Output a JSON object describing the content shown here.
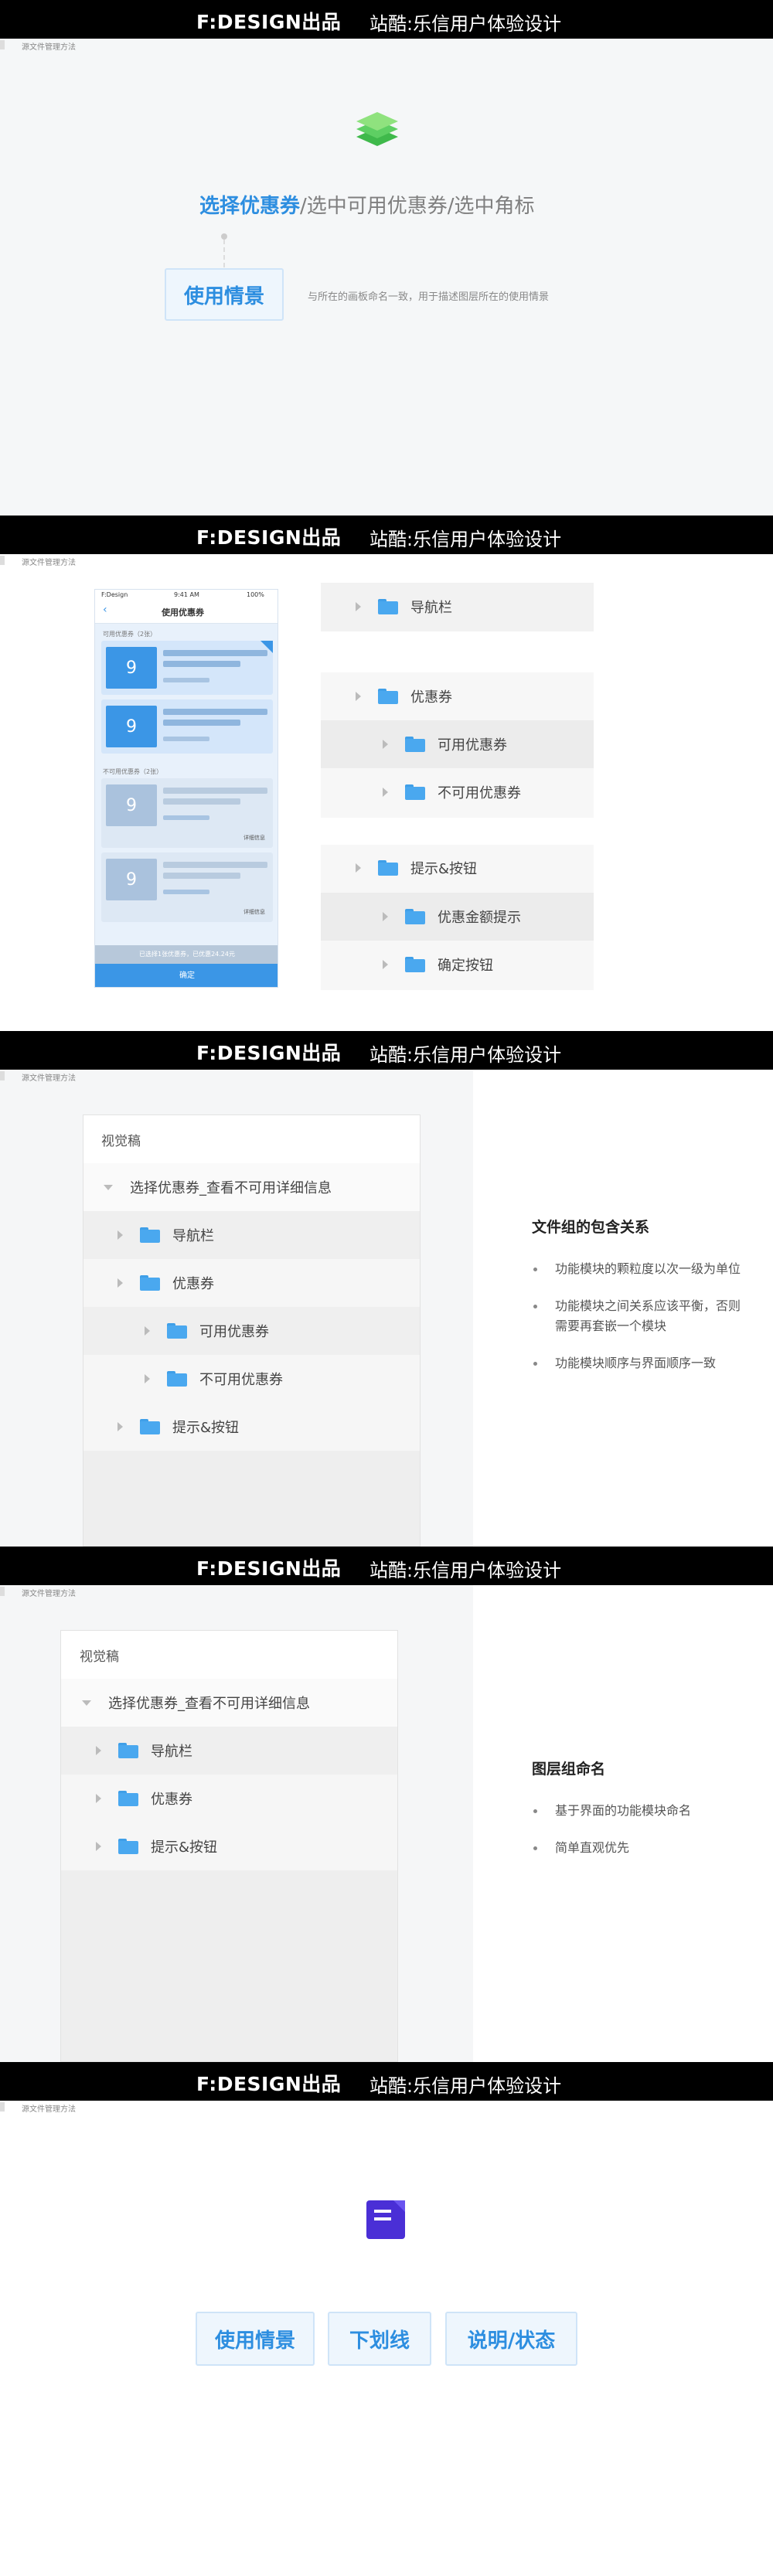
{
  "banner": {
    "logo": "F:DESIGN出品",
    "tagline": "站酷:乐信用户体验设计"
  },
  "micro_label": "源文件管理方法",
  "section1": {
    "title_blue": "选择优惠券",
    "title_rest": "/选中可用优惠券/选中角标",
    "tag": "使用情景",
    "caption": "与所在的画板命名一致，用于描述图层所在的使用情景"
  },
  "section2": {
    "phone": {
      "status_left": "F:Design",
      "status_time": "9:41 AM",
      "status_right": "100%",
      "nav_title": "使用优惠券",
      "group_available": "可用优惠券（2张）",
      "group_unavailable": "不可用优惠券（2张）",
      "coupon_value": "9",
      "more_link": "详细信息",
      "summary": "已选择1张优惠券，已优惠24.24元",
      "confirm": "确定"
    },
    "tree_group1": [
      {
        "label": "导航栏"
      }
    ],
    "tree_group2": [
      {
        "label": "优惠券"
      },
      {
        "label": "可用优惠券"
      },
      {
        "label": "不可用优惠券"
      }
    ],
    "tree_group3": [
      {
        "label": "提示&按钮"
      },
      {
        "label": "优惠金额提示"
      },
      {
        "label": "确定按钮"
      }
    ]
  },
  "section3": {
    "panel_header": "视觉稿",
    "root": "选择优惠券_查看不可用详细信息",
    "items": [
      "导航栏",
      "优惠券",
      "可用优惠券",
      "不可用优惠券",
      "提示&按钮"
    ],
    "heading": "文件组的包含关系",
    "bullets": [
      "功能模块的颗粒度以次一级为单位",
      "功能模块之间关系应该平衡，否则需要再套嵌一个模块",
      "功能模块顺序与界面顺序一致"
    ]
  },
  "section4": {
    "panel_header": "视觉稿",
    "root": "选择优惠券_查看不可用详细信息",
    "items": [
      "导航栏",
      "优惠券",
      "提示&按钮"
    ],
    "heading": "图层组命名",
    "bullets": [
      "基于界面的功能模块命名",
      "简单直观优先"
    ]
  },
  "section5": {
    "tags": [
      "使用情景",
      "下划线",
      "说明/状态"
    ]
  },
  "colors": {
    "accent": "#2d8ee0",
    "folder": "#4aa8ef",
    "banner": "#000000"
  }
}
